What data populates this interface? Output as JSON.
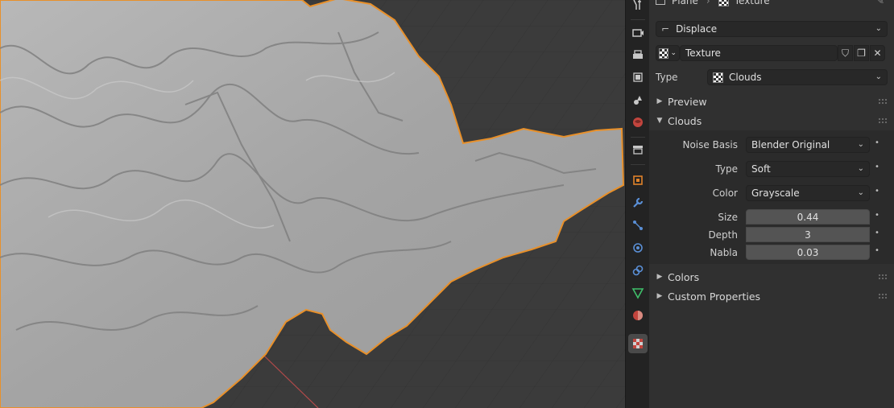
{
  "header": {
    "object_name": "Plane",
    "texture_crumb": "Texture"
  },
  "modifier": {
    "name": "Displace"
  },
  "texture": {
    "name": "Texture",
    "type_label": "Type",
    "type_value": "Clouds"
  },
  "panels": {
    "preview": "Preview",
    "clouds": "Clouds",
    "colors": "Colors",
    "custom_properties": "Custom Properties"
  },
  "clouds": {
    "noise_basis_label": "Noise Basis",
    "noise_basis_value": "Blender Original",
    "type_label": "Type",
    "type_value": "Soft",
    "color_label": "Color",
    "color_value": "Grayscale",
    "size_label": "Size",
    "size_value": "0.44",
    "depth_label": "Depth",
    "depth_value": "3",
    "nabla_label": "Nabla",
    "nabla_value": "0.03"
  },
  "tabs": [
    {
      "icon": "tool-icon"
    },
    {
      "icon": "render-icon"
    },
    {
      "icon": "output-icon"
    },
    {
      "icon": "view-layer-icon"
    },
    {
      "icon": "scene-icon"
    },
    {
      "icon": "world-icon"
    },
    {
      "icon": "collection-icon"
    },
    {
      "icon": "object-icon"
    },
    {
      "icon": "modifier-wrench-icon"
    },
    {
      "icon": "particles-icon"
    },
    {
      "icon": "physics-icon"
    },
    {
      "icon": "constraints-icon"
    },
    {
      "icon": "object-data-icon"
    },
    {
      "icon": "material-icon"
    },
    {
      "icon": "texture-icon"
    }
  ],
  "colors": {
    "selection_outline": "#e8902a",
    "mesh": "#a9a9a9",
    "viewport_bg": "#3b3b3b",
    "panel_bg": "#303030"
  }
}
